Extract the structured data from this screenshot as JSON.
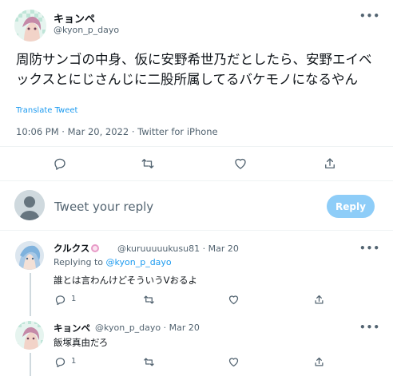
{
  "main_tweet": {
    "author_name": "キョンペ",
    "author_handle": "@kyon_p_dayo",
    "text": "周防サンゴの中身、仮に安野希世乃だとしたら、安野エイベックスとにじさんじに二股所属してるバケモノになるやん",
    "translate_label": "Translate Tweet",
    "timestamp": "10:06 PM · Mar 20, 2022 · Twitter for iPhone",
    "actions": [
      "reply-icon",
      "retweet-icon",
      "like-icon",
      "share-icon"
    ]
  },
  "compose": {
    "placeholder": "Tweet your reply",
    "button_label": "Reply"
  },
  "replies": [
    {
      "name": "クルクス",
      "badge": "pink-circle-icon",
      "handle": "@kuruuuuukusu81",
      "separator": "·",
      "date": "Mar 20",
      "replying_prefix": "Replying to",
      "replying_to": "@kyon_p_dayo",
      "text": "誰とは言わんけどそういうVおるよ",
      "reply_count": "1"
    },
    {
      "name": "キョンペ",
      "handle": "@kyon_p_dayo",
      "separator": "·",
      "date": "Mar 20",
      "text": "飯塚真由だろ",
      "reply_count": "1"
    }
  ],
  "colors": {
    "accent": "#1d9bf0",
    "reply_button_disabled": "#8ecdf8",
    "secondary_text": "#536471",
    "divider": "#eff3f4"
  }
}
